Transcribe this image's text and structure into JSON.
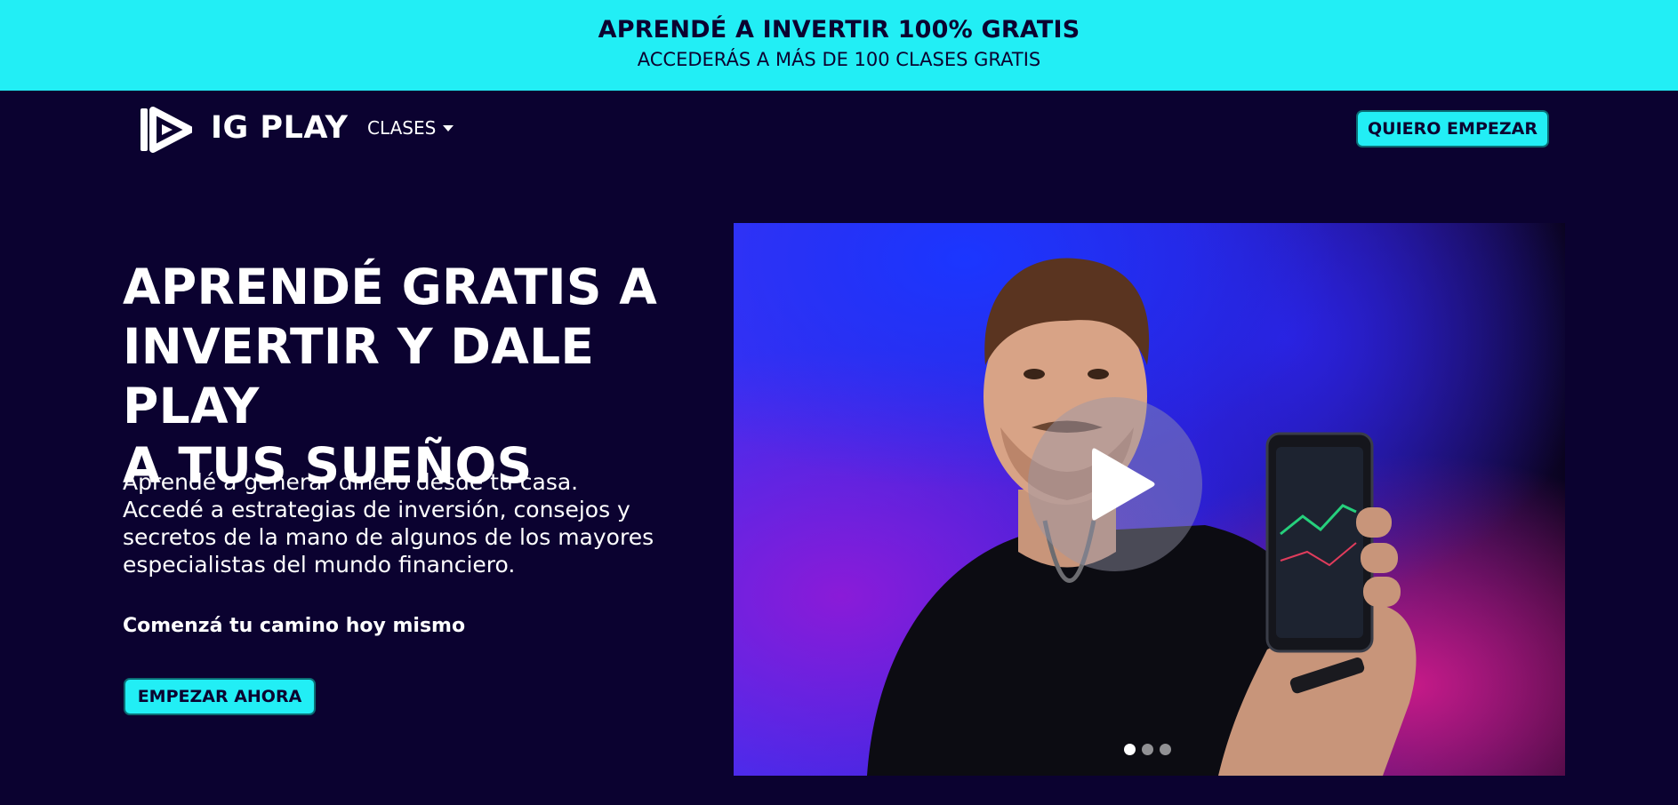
{
  "promo": {
    "title": "APRENDÉ A INVERTIR 100% GRATIS",
    "subtitle": "ACCEDERÁS A MÁS DE 100 CLASES GRATIS"
  },
  "nav": {
    "brand": "IG PLAY",
    "menu_label": "CLASES",
    "cta_label": "QUIERO EMPEZAR"
  },
  "hero": {
    "title_lines": [
      "APRENDÉ GRATIS A",
      "INVERTIR Y DALE PLAY",
      "A TUS SUEÑOS"
    ],
    "description_lines": [
      "Aprendé a generar dinero desde tu casa.",
      "Accedé a estrategias de inversión, consejos y",
      "secretos de la mano de algunos de los mayores",
      "especialistas del mundo financiero."
    ],
    "tagline": "Comenzá tu camino hoy mismo",
    "cta_label": "EMPEZAR AHORA"
  },
  "video": {
    "slides_count": 3,
    "active_slide": 1
  },
  "colors": {
    "background": "#0b0230",
    "accent": "#22eef5",
    "accent_text": "#0b0230"
  }
}
